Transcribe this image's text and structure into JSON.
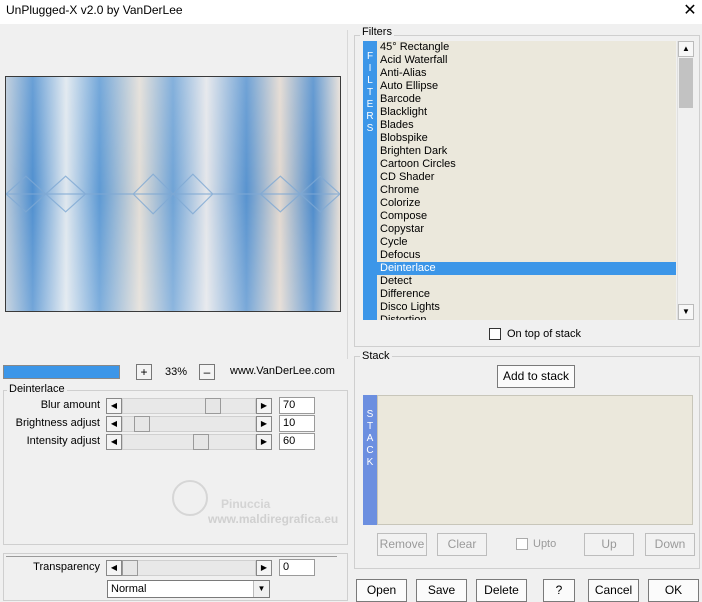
{
  "window": {
    "title": "UnPlugged-X v2.0 by VanDerLee",
    "close_glyph": "✕"
  },
  "preview": {
    "alt": "preview"
  },
  "zoom": {
    "progress": 1.0,
    "minus": "–",
    "plus": "+",
    "value": "33%",
    "website": "www.VanDerLee.com"
  },
  "params": {
    "group_label": "Deinterlace",
    "sliders": [
      {
        "label": "Blur amount",
        "value": "70",
        "level": 0.7
      },
      {
        "label": "Brightness adjust",
        "value": "10",
        "level": 0.1
      },
      {
        "label": "Intensity adjust",
        "value": "60",
        "level": 0.6
      }
    ],
    "transparency": {
      "label": "Transparency",
      "value": "0",
      "level": 0.0
    },
    "blend_mode": "Normal"
  },
  "filters": {
    "group_label": "Filters",
    "strip_letters": [
      "F",
      "I",
      "L",
      "T",
      "E",
      "R",
      "S"
    ],
    "items": [
      "45° Rectangle",
      "Acid Waterfall",
      "Anti-Alias",
      "Auto Ellipse",
      "Barcode",
      "Blacklight",
      "Blades",
      "Blobspike",
      "Brighten Dark",
      "Cartoon Circles",
      "CD Shader",
      "Chrome",
      "Colorize",
      "Compose",
      "Copystar",
      "Cycle",
      "Defocus",
      "Deinterlace",
      "Detect",
      "Difference",
      "Disco Lights",
      "Distortion"
    ],
    "selected": "Deinterlace",
    "on_top_label": "On top of stack"
  },
  "stack": {
    "group_label": "Stack",
    "add_button": "Add to stack",
    "strip_letters": [
      "S",
      "T",
      "A",
      "C",
      "K"
    ],
    "remove": "Remove",
    "clear": "Clear",
    "upto": "Upto",
    "up": "Up",
    "down": "Down"
  },
  "footer": {
    "open": "Open",
    "save": "Save",
    "delete": "Delete",
    "help": "?",
    "cancel": "Cancel",
    "ok": "OK"
  },
  "watermark": {
    "line1": "Pinuccia",
    "line2": "www.maldiregrafica.eu"
  },
  "colors": {
    "accent": "#3c96e8",
    "list_bg": "#ebe8dc",
    "stack_strip": "#6c8fe0"
  }
}
